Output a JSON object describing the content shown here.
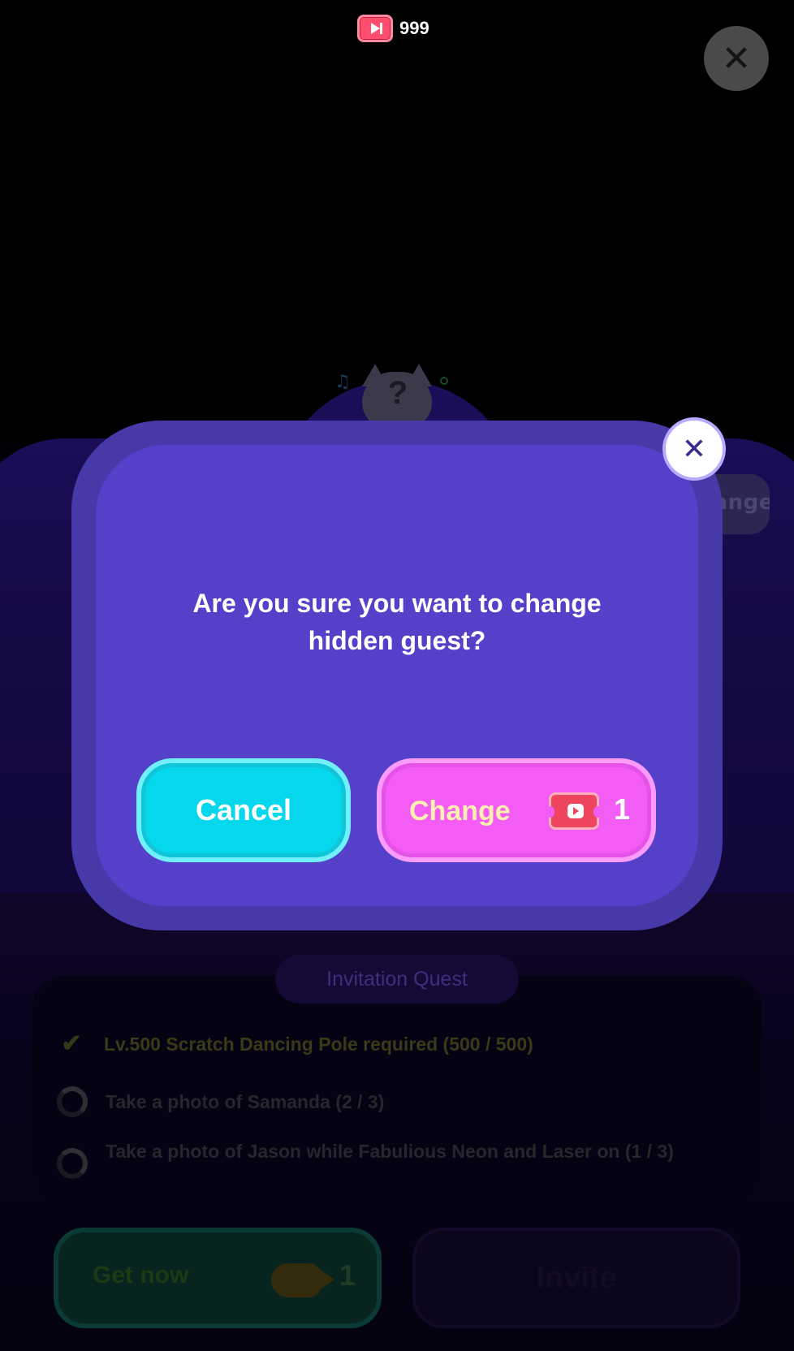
{
  "header": {
    "coin_icon": "ticket-icon",
    "coin_count": "999",
    "close_icon": "close-icon"
  },
  "background": {
    "guest_icon": "hidden-guest-cat-icon",
    "guest_mark": "?",
    "change_button_label": "Change",
    "quest": {
      "title": "Invitation Quest",
      "items": [
        {
          "label": "Lv.500 Scratch Dancing Pole required (500 / 500)",
          "status": "complete"
        },
        {
          "label": "Take a photo of Samanda (2 / 3)",
          "status": "in-progress"
        },
        {
          "label": "Take a photo of Jason while Fabulious Neon and Laser on (1 / 3)",
          "status": "in-progress"
        }
      ]
    },
    "get_now": {
      "label": "Get now",
      "cost_icon": "fish-icon",
      "cost": "1"
    },
    "invite": {
      "label": "Invite"
    }
  },
  "dialog": {
    "message": "Are you sure you want to change hidden guest?",
    "close_icon": "close-icon",
    "cancel_label": "Cancel",
    "confirm_label": "Change",
    "confirm_cost_icon": "ticket-icon",
    "confirm_cost": "1"
  },
  "colors": {
    "dialog_outer": "#4639a8",
    "dialog_inner": "#5440c9",
    "cancel_button": "#05d8ec",
    "change_button": "#f35cf5",
    "ticket": "#f0455e"
  }
}
